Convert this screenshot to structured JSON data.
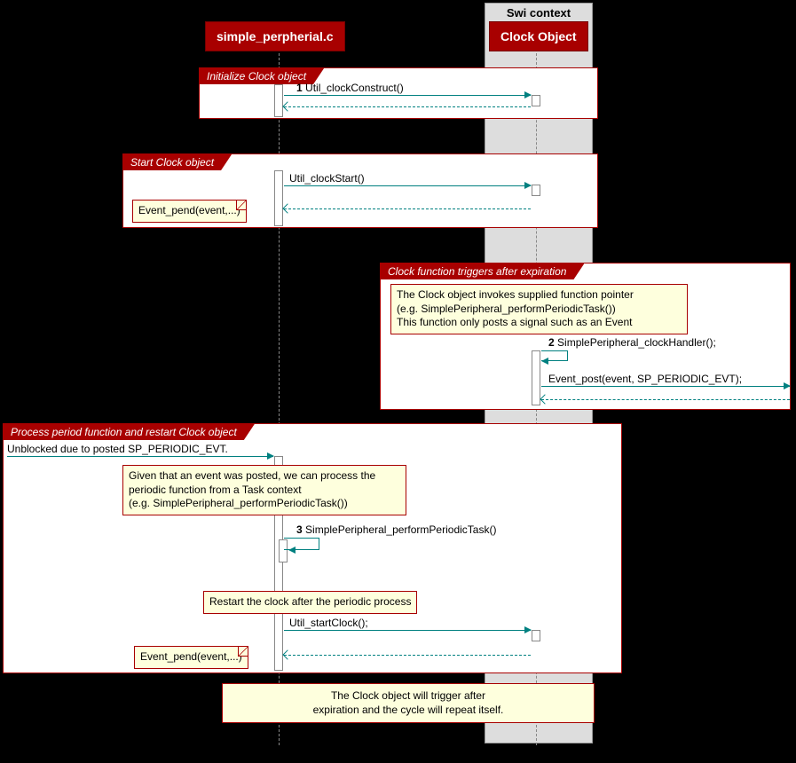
{
  "swi_box_label": "Swi context",
  "participants": {
    "left": "simple_perpherial.c",
    "right": "Clock Object"
  },
  "groups": {
    "g1": {
      "label": "Initialize Clock object"
    },
    "g2": {
      "label": "Start Clock object"
    },
    "g3": {
      "label": "Clock function triggers after expiration"
    },
    "g4": {
      "label": "Process period function and restart Clock object"
    }
  },
  "messages": {
    "m1": {
      "num": "1",
      "text": "Util_clockConstruct()"
    },
    "m2": {
      "text": "Util_clockStart()"
    },
    "m3": {
      "num": "2",
      "text": "SimplePeripheral_clockHandler();"
    },
    "m4": {
      "text": "Event_post(event, SP_PERIODIC_EVT);"
    },
    "m5": {
      "text": "Unblocked due to posted SP_PERIODIC_EVT."
    },
    "m6": {
      "num": "3",
      "text": "SimplePeripheral_performPeriodicTask()"
    },
    "m7": {
      "text": "Util_startClock();"
    }
  },
  "notes": {
    "n1": "Event_pend(event,...)",
    "n2_l1": "The Clock object invokes supplied function pointer",
    "n2_l2": "(e.g. SimplePeripheral_performPeriodicTask())",
    "n2_l3": "This function only posts a signal such as an Event",
    "n3_l1": "Given that an event was posted, we can process the",
    "n3_l2": "periodic function from a Task context",
    "n3_l3": "(e.g. SimplePeripheral_performPeriodicTask())",
    "n4": "Restart the clock after the periodic process",
    "n5": "Event_pend(event,...)",
    "caption_l1": "The Clock object will trigger after",
    "caption_l2": "expiration and the cycle will repeat itself."
  }
}
